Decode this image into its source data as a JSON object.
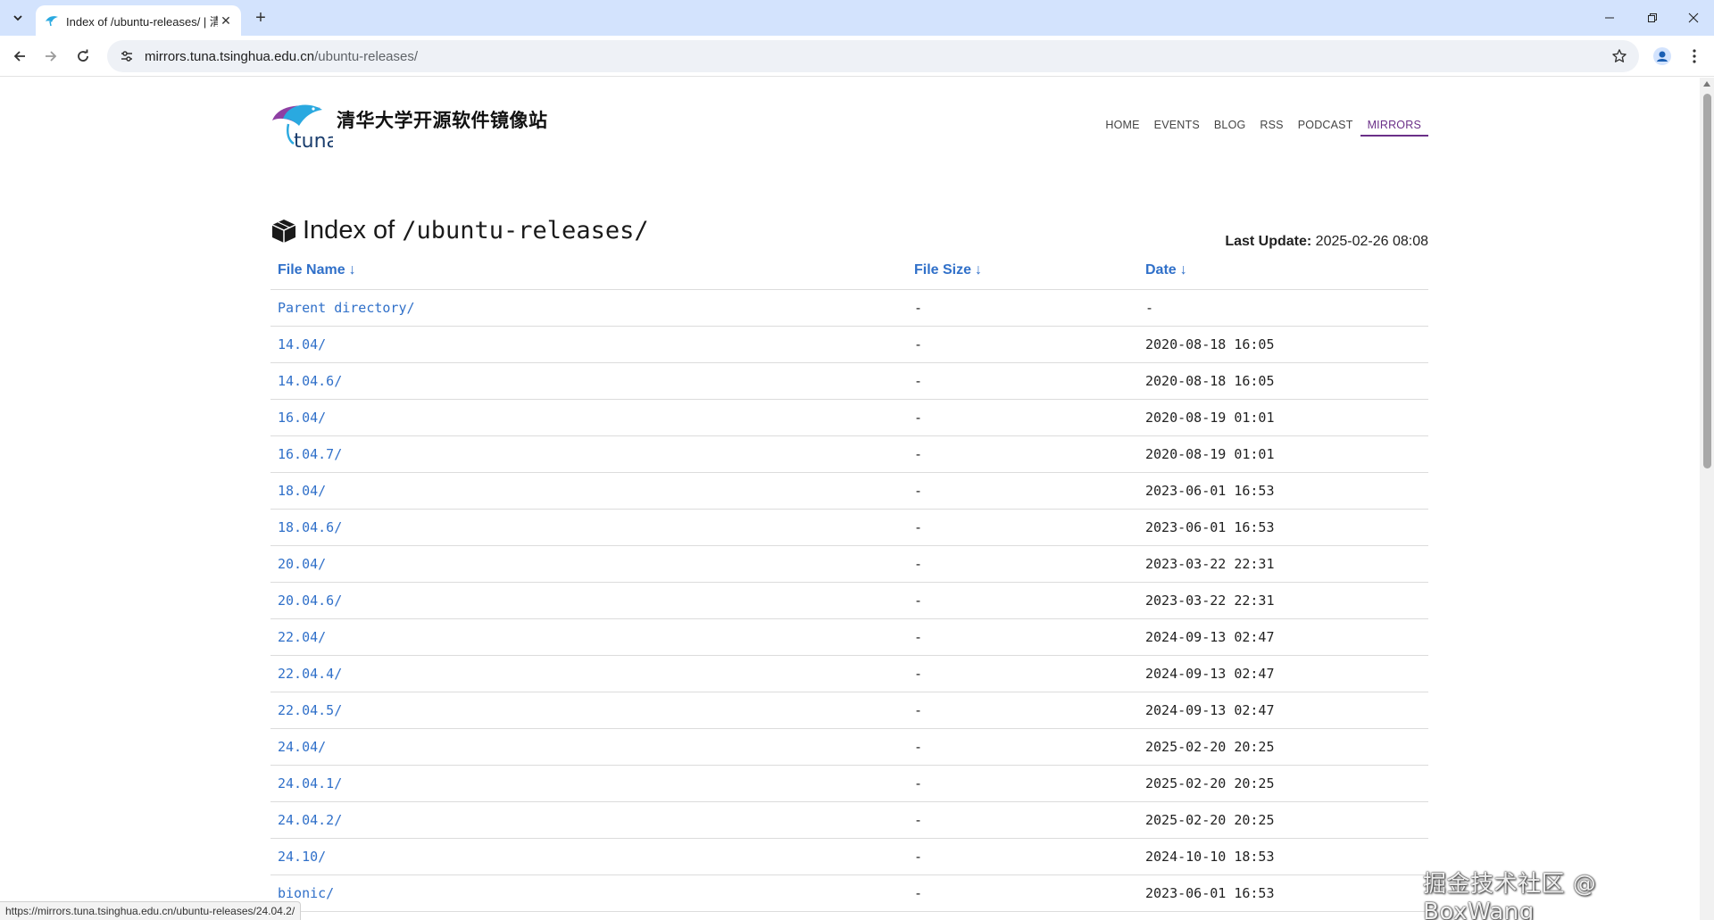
{
  "browser": {
    "tab_title": "Index of /ubuntu-releases/ | 清华大学开源软件镜像站",
    "url_host": "mirrors.tuna.tsinghua.edu.cn",
    "url_path": "/ubuntu-releases/"
  },
  "site": {
    "logo_text": "tuna",
    "title": "清华大学开源软件镜像站",
    "nav": [
      "HOME",
      "EVENTS",
      "BLOG",
      "RSS",
      "PODCAST",
      "MIRRORS"
    ],
    "active_nav": "MIRRORS"
  },
  "index": {
    "title_prefix": "Index of ",
    "title_path": "/ubuntu-releases/",
    "last_update_label": "Last Update:",
    "last_update_value": " 2025-02-26 08:08"
  },
  "table": {
    "headers": {
      "name": "File Name",
      "size": "File Size",
      "date": "Date",
      "sort_arrow": "↓"
    },
    "rows": [
      {
        "name": "Parent directory/",
        "size": "-",
        "date": "-"
      },
      {
        "name": "14.04/",
        "size": "-",
        "date": "2020-08-18 16:05"
      },
      {
        "name": "14.04.6/",
        "size": "-",
        "date": "2020-08-18 16:05"
      },
      {
        "name": "16.04/",
        "size": "-",
        "date": "2020-08-19 01:01"
      },
      {
        "name": "16.04.7/",
        "size": "-",
        "date": "2020-08-19 01:01"
      },
      {
        "name": "18.04/",
        "size": "-",
        "date": "2023-06-01 16:53"
      },
      {
        "name": "18.04.6/",
        "size": "-",
        "date": "2023-06-01 16:53"
      },
      {
        "name": "20.04/",
        "size": "-",
        "date": "2023-03-22 22:31"
      },
      {
        "name": "20.04.6/",
        "size": "-",
        "date": "2023-03-22 22:31"
      },
      {
        "name": "22.04/",
        "size": "-",
        "date": "2024-09-13 02:47"
      },
      {
        "name": "22.04.4/",
        "size": "-",
        "date": "2024-09-13 02:47"
      },
      {
        "name": "22.04.5/",
        "size": "-",
        "date": "2024-09-13 02:47"
      },
      {
        "name": "24.04/",
        "size": "-",
        "date": "2025-02-20 20:25"
      },
      {
        "name": "24.04.1/",
        "size": "-",
        "date": "2025-02-20 20:25"
      },
      {
        "name": "24.04.2/",
        "size": "-",
        "date": "2025-02-20 20:25"
      },
      {
        "name": "24.10/",
        "size": "-",
        "date": "2024-10-10 18:53"
      },
      {
        "name": "bionic/",
        "size": "-",
        "date": "2023-06-01 16:53"
      }
    ]
  },
  "status_bar": "https://mirrors.tuna.tsinghua.edu.cn/ubuntu-releases/24.04.2/",
  "watermark": "掘金技术社区 @ BoxWang",
  "colors": {
    "link": "#3070c9",
    "active_nav": "#6a2f88",
    "tab_strip": "#d3e3fd"
  }
}
